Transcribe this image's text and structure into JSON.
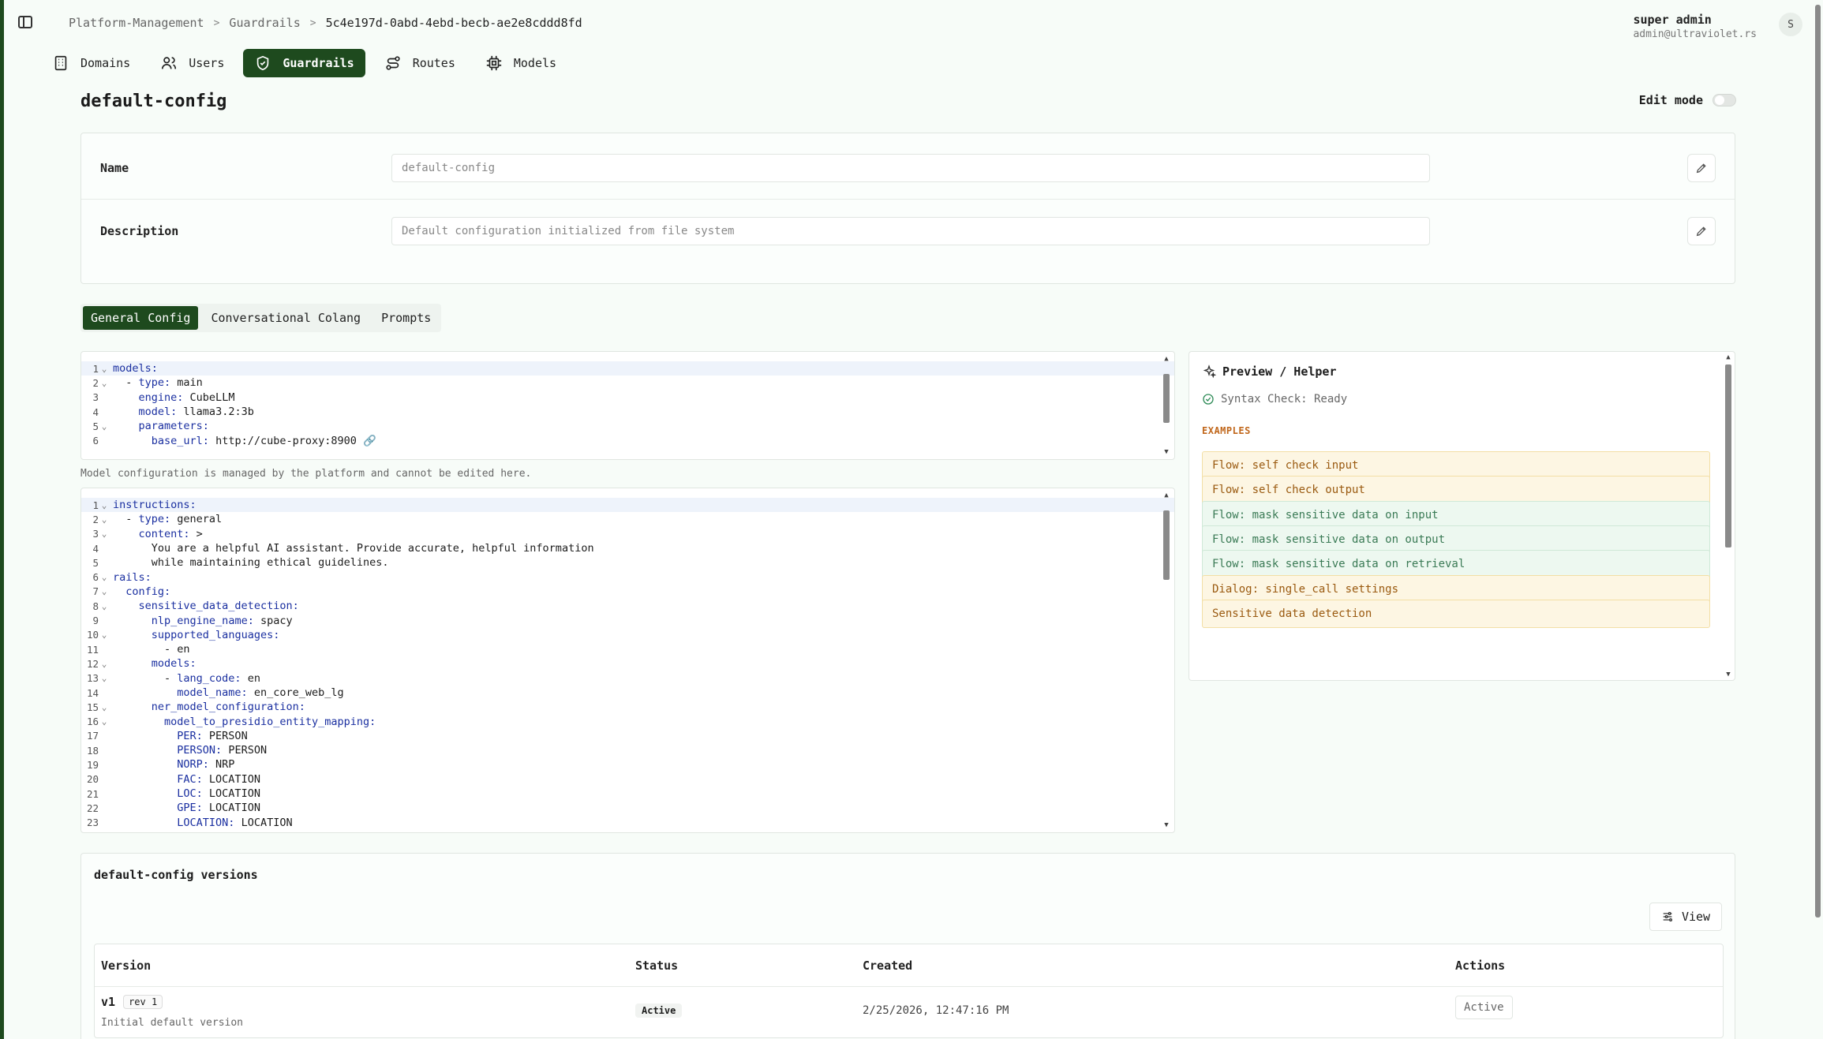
{
  "breadcrumb": {
    "root": "Platform-Management",
    "section": "Guardrails",
    "current": "5c4e197d-0abd-4ebd-becb-ae2e8cddd8fd"
  },
  "user": {
    "name": "super admin",
    "email": "admin@ultraviolet.rs",
    "initial": "S"
  },
  "nav": {
    "domains": "Domains",
    "users": "Users",
    "guardrails": "Guardrails",
    "routes": "Routes",
    "models": "Models"
  },
  "page": {
    "title": "default-config",
    "edit_mode_label": "Edit mode"
  },
  "meta": {
    "name_label": "Name",
    "name_value": "default-config",
    "description_label": "Description",
    "description_value": "Default configuration initialized from file system"
  },
  "tabs": {
    "general": "General Config",
    "colang": "Conversational Colang",
    "prompts": "Prompts"
  },
  "editor1": {
    "note": "Model configuration is managed by the platform and cannot be edited here.",
    "lines": [
      {
        "n": "1",
        "f": "⌄",
        "t": "<span class='k'>models:</span>"
      },
      {
        "n": "2",
        "f": "⌄",
        "t": "  - <span class='k'>type:</span> main"
      },
      {
        "n": "3",
        "f": "",
        "t": "    <span class='k'>engine:</span> CubeLLM"
      },
      {
        "n": "4",
        "f": "",
        "t": "    <span class='k'>model:</span> llama3.2:3b"
      },
      {
        "n": "5",
        "f": "⌄",
        "t": "    <span class='k'>parameters:</span>"
      },
      {
        "n": "6",
        "f": "",
        "t": "      <span class='k'>base_url:</span> http://cube-proxy:8900 🔗"
      }
    ]
  },
  "editor2": {
    "lines": [
      {
        "n": "1",
        "f": "⌄",
        "t": "<span class='k'>instructions:</span>"
      },
      {
        "n": "2",
        "f": "⌄",
        "t": "  - <span class='k'>type:</span> general"
      },
      {
        "n": "3",
        "f": "⌄",
        "t": "    <span class='k'>content:</span> >"
      },
      {
        "n": "4",
        "f": "",
        "t": "      You are a helpful AI assistant. Provide accurate, helpful information"
      },
      {
        "n": "5",
        "f": "",
        "t": "      while maintaining ethical guidelines."
      },
      {
        "n": "6",
        "f": "⌄",
        "t": "<span class='k'>rails:</span>"
      },
      {
        "n": "7",
        "f": "⌄",
        "t": "  <span class='k'>config:</span>"
      },
      {
        "n": "8",
        "f": "⌄",
        "t": "    <span class='k'>sensitive_data_detection:</span>"
      },
      {
        "n": "9",
        "f": "",
        "t": "      <span class='k'>nlp_engine_name:</span> spacy"
      },
      {
        "n": "10",
        "f": "⌄",
        "t": "      <span class='k'>supported_languages:</span>"
      },
      {
        "n": "11",
        "f": "",
        "t": "        - en"
      },
      {
        "n": "12",
        "f": "⌄",
        "t": "      <span class='k'>models:</span>"
      },
      {
        "n": "13",
        "f": "⌄",
        "t": "        - <span class='k'>lang_code:</span> en"
      },
      {
        "n": "14",
        "f": "",
        "t": "          <span class='k'>model_name:</span> en_core_web_lg"
      },
      {
        "n": "15",
        "f": "⌄",
        "t": "      <span class='k'>ner_model_configuration:</span>"
      },
      {
        "n": "16",
        "f": "⌄",
        "t": "        <span class='k'>model_to_presidio_entity_mapping:</span>"
      },
      {
        "n": "17",
        "f": "",
        "t": "          <span class='k'>PER:</span> PERSON"
      },
      {
        "n": "18",
        "f": "",
        "t": "          <span class='k'>PERSON:</span> PERSON"
      },
      {
        "n": "19",
        "f": "",
        "t": "          <span class='k'>NORP:</span> NRP"
      },
      {
        "n": "20",
        "f": "",
        "t": "          <span class='k'>FAC:</span> LOCATION"
      },
      {
        "n": "21",
        "f": "",
        "t": "          <span class='k'>LOC:</span> LOCATION"
      },
      {
        "n": "22",
        "f": "",
        "t": "          <span class='k'>GPE:</span> LOCATION"
      },
      {
        "n": "23",
        "f": "",
        "t": "          <span class='k'>LOCATION:</span> LOCATION"
      }
    ]
  },
  "helper": {
    "title": "Preview / Helper",
    "syntax": "Syntax Check: Ready",
    "examples_heading": "EXAMPLES",
    "examples": [
      {
        "label": "Flow: self check input",
        "tone": "y"
      },
      {
        "label": "Flow: self check output",
        "tone": "y"
      },
      {
        "label": "Flow: mask sensitive data on input",
        "tone": "g"
      },
      {
        "label": "Flow: mask sensitive data on output",
        "tone": "g"
      },
      {
        "label": "Flow: mask sensitive data on retrieval",
        "tone": "g"
      },
      {
        "label": "Dialog: single_call settings",
        "tone": "y"
      },
      {
        "label": "Sensitive data detection",
        "tone": "y"
      }
    ]
  },
  "versions": {
    "title": "default-config versions",
    "view_label": "View",
    "headers": {
      "version": "Version",
      "status": "Status",
      "created": "Created",
      "actions": "Actions"
    },
    "row": {
      "version": "v1",
      "rev": "rev 1",
      "note": "Initial default version",
      "status": "Active",
      "created": "2/25/2026, 12:47:16 PM",
      "action": "Active"
    }
  }
}
